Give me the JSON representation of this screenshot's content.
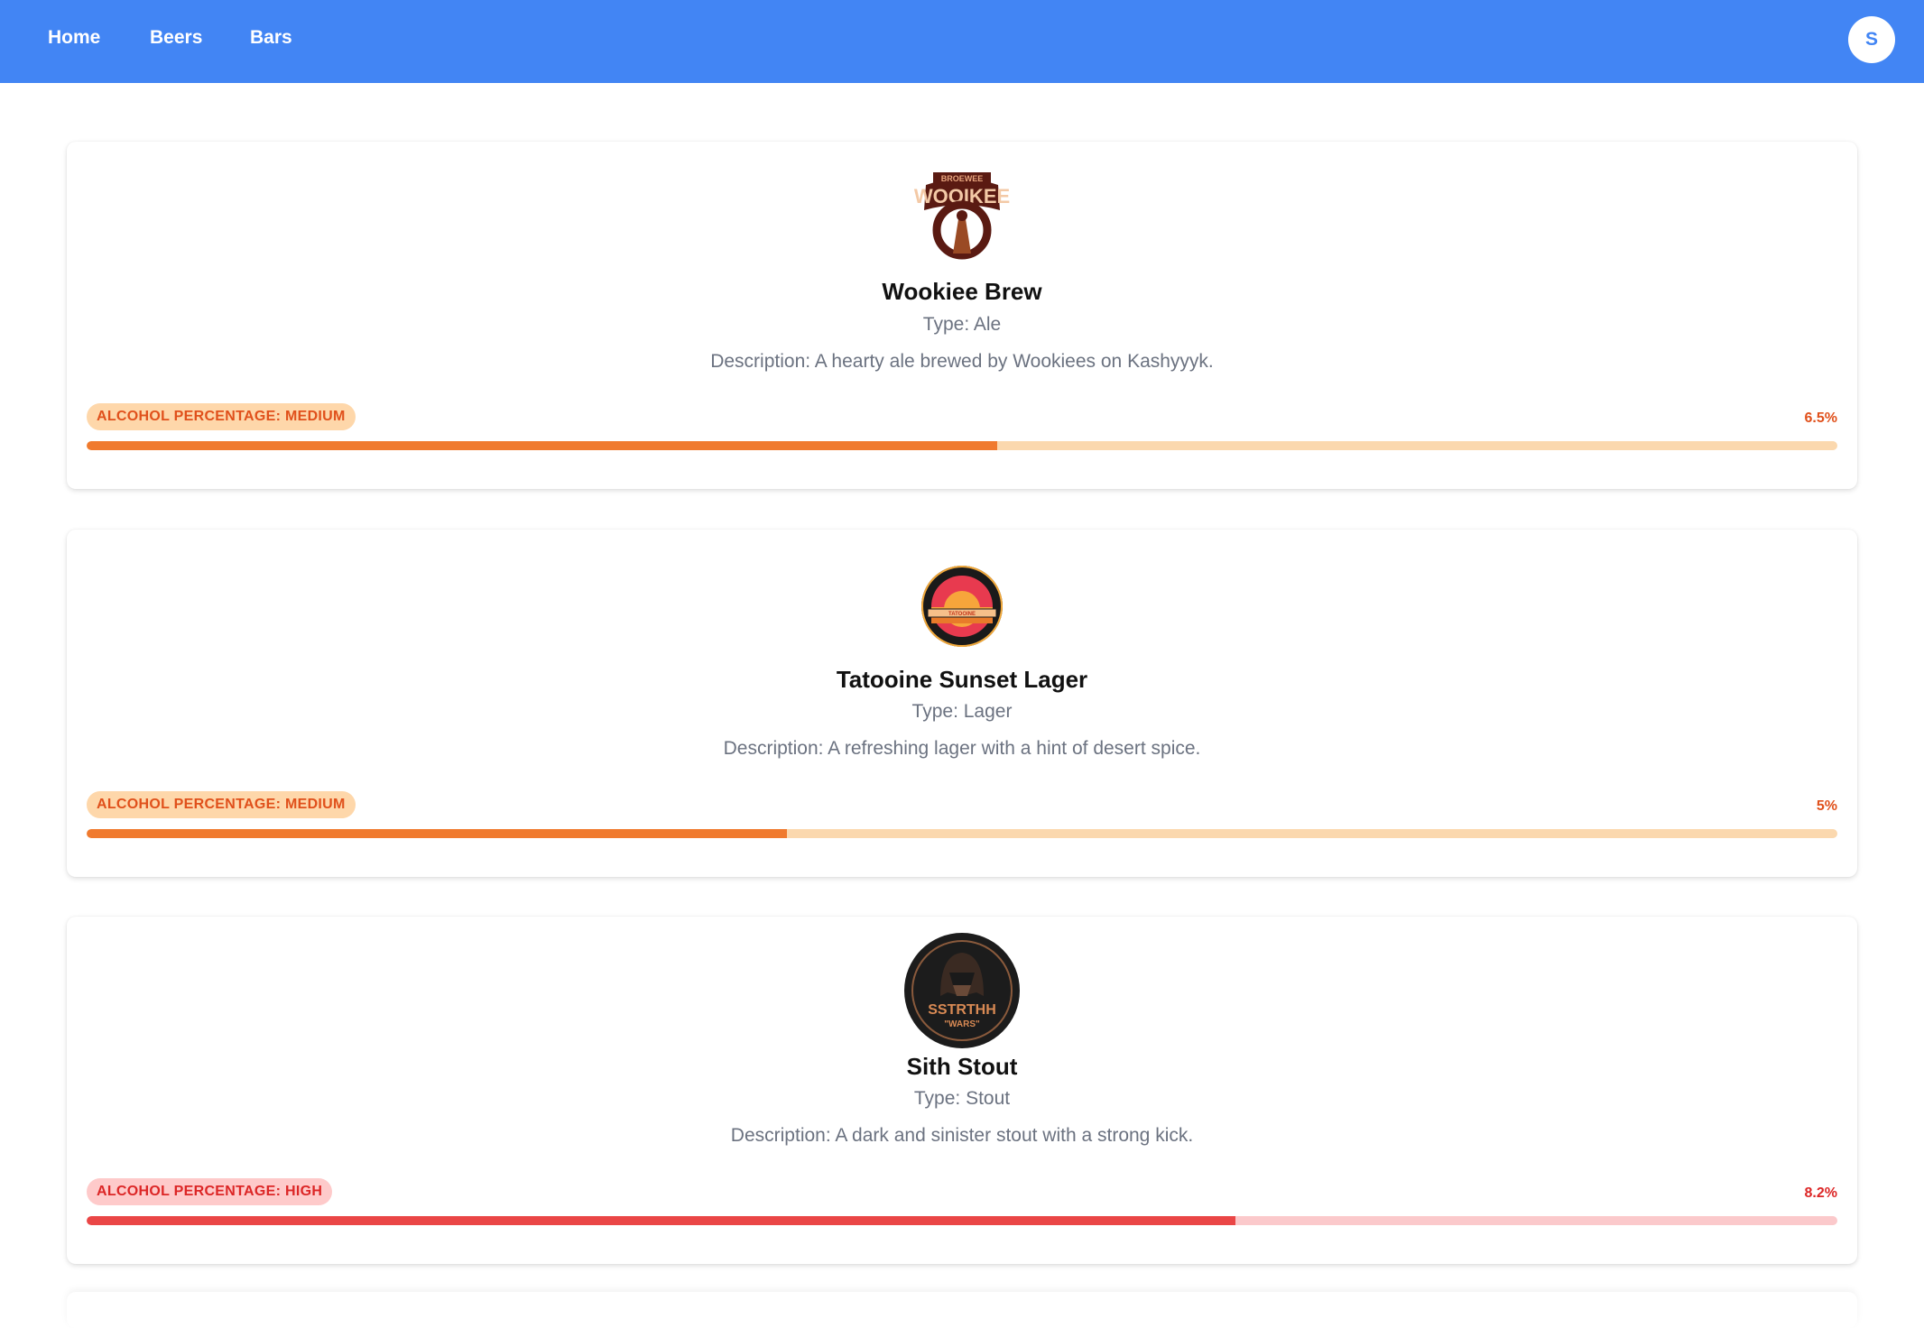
{
  "nav": {
    "links": [
      {
        "label": "Home"
      },
      {
        "label": "Beers"
      },
      {
        "label": "Bars"
      }
    ],
    "avatar_initial": "S"
  },
  "beers": [
    {
      "name": "Wookiee Brew",
      "type": "Type: Ale",
      "description": "Description: A hearty ale brewed by Wookiees on Kashyyyk.",
      "alcohol_label": "ALCOHOL PERCENTAGE: MEDIUM",
      "alcohol_value": "6.5%",
      "alcohol_fraction": 0.52,
      "logo_text": "WOOIKEE",
      "logo_icon": "wookiee-brew-logo",
      "colors": {
        "fill": "#f07a2e",
        "track": "#fbd8ae",
        "badge_bg": "#fed7aa",
        "text": "#e0501b"
      }
    },
    {
      "name": "Tatooine Sunset Lager",
      "type": "Type: Lager",
      "description": "Description: A refreshing lager with a hint of desert spice.",
      "alcohol_label": "ALCOHOL PERCENTAGE: MEDIUM",
      "alcohol_value": "5%",
      "alcohol_fraction": 0.4,
      "logo_text": "TATOOINE",
      "logo_icon": "tatooine-sunset-logo",
      "colors": {
        "fill": "#f07a2e",
        "track": "#fbd8ae",
        "badge_bg": "#fed7aa",
        "text": "#e0501b"
      }
    },
    {
      "name": "Sith Stout",
      "type": "Type: Stout",
      "description": "Description: A dark and sinister stout with a strong kick.",
      "alcohol_label": "ALCOHOL PERCENTAGE: HIGH",
      "alcohol_value": "8.2%",
      "alcohol_fraction": 0.656,
      "logo_text": "SSTRTHH",
      "logo_subtext": "\"WARS\"",
      "logo_icon": "sith-stout-logo",
      "colors": {
        "fill": "#ea4646",
        "track": "#fbc9cb",
        "badge_bg": "#fecaca",
        "text": "#dc2626"
      }
    }
  ],
  "theme": {
    "primary": "#4285f4"
  }
}
